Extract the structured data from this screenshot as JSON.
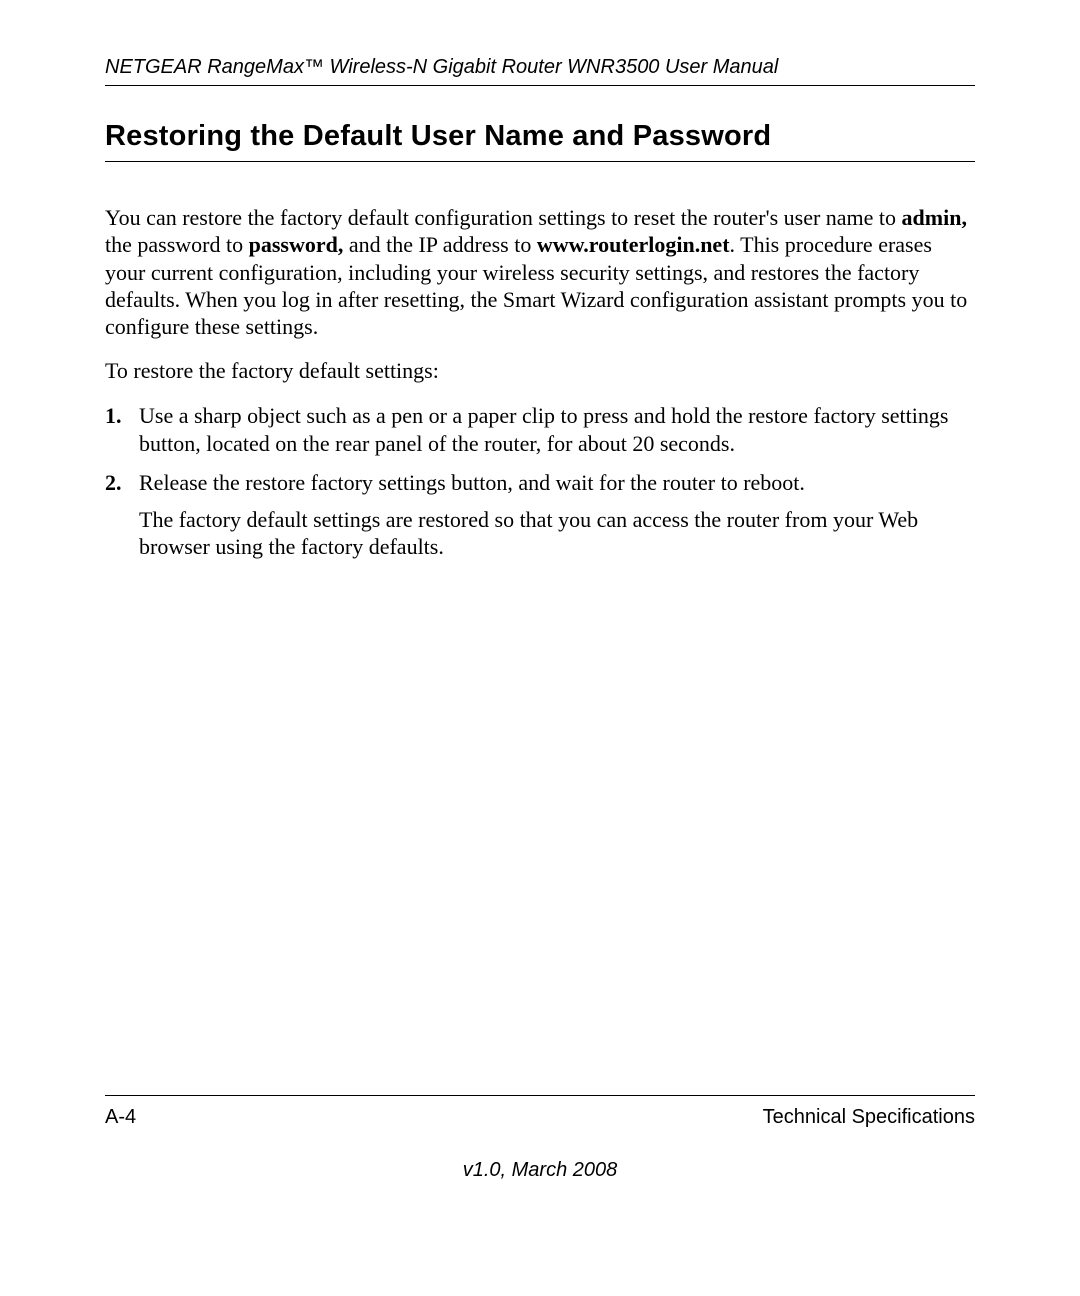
{
  "header": {
    "running_title": "NETGEAR RangeMax™ Wireless-N Gigabit Router WNR3500 User Manual"
  },
  "section": {
    "title": "Restoring the Default User Name and Password",
    "intro_parts": {
      "p1": "You can restore the factory default configuration settings to reset the router's user name to ",
      "b1": "admin,",
      "p2": " the password to ",
      "b2": "password,",
      "p3": " and the IP address to ",
      "b3": "www.routerlogin.net",
      "p4": ". This procedure erases your current configuration, including your wireless security settings, and restores the factory defaults. When you log in after resetting, the Smart Wizard configuration assistant prompts you to configure these settings."
    },
    "lead_in": "To restore the factory default settings:",
    "steps": [
      {
        "num": "1.",
        "text": "Use a sharp object such as a pen or a paper clip to press and hold the restore factory settings button, located on the rear panel of the router, for about 20 seconds."
      },
      {
        "num": "2.",
        "text": "Release the restore factory settings button, and wait for the router to reboot."
      }
    ],
    "step2_followup": "The factory default settings are restored so that you can access the router from your Web browser using the factory defaults."
  },
  "footer": {
    "page_number": "A-4",
    "section_name": "Technical Specifications",
    "version_line": "v1.0, March 2008"
  }
}
